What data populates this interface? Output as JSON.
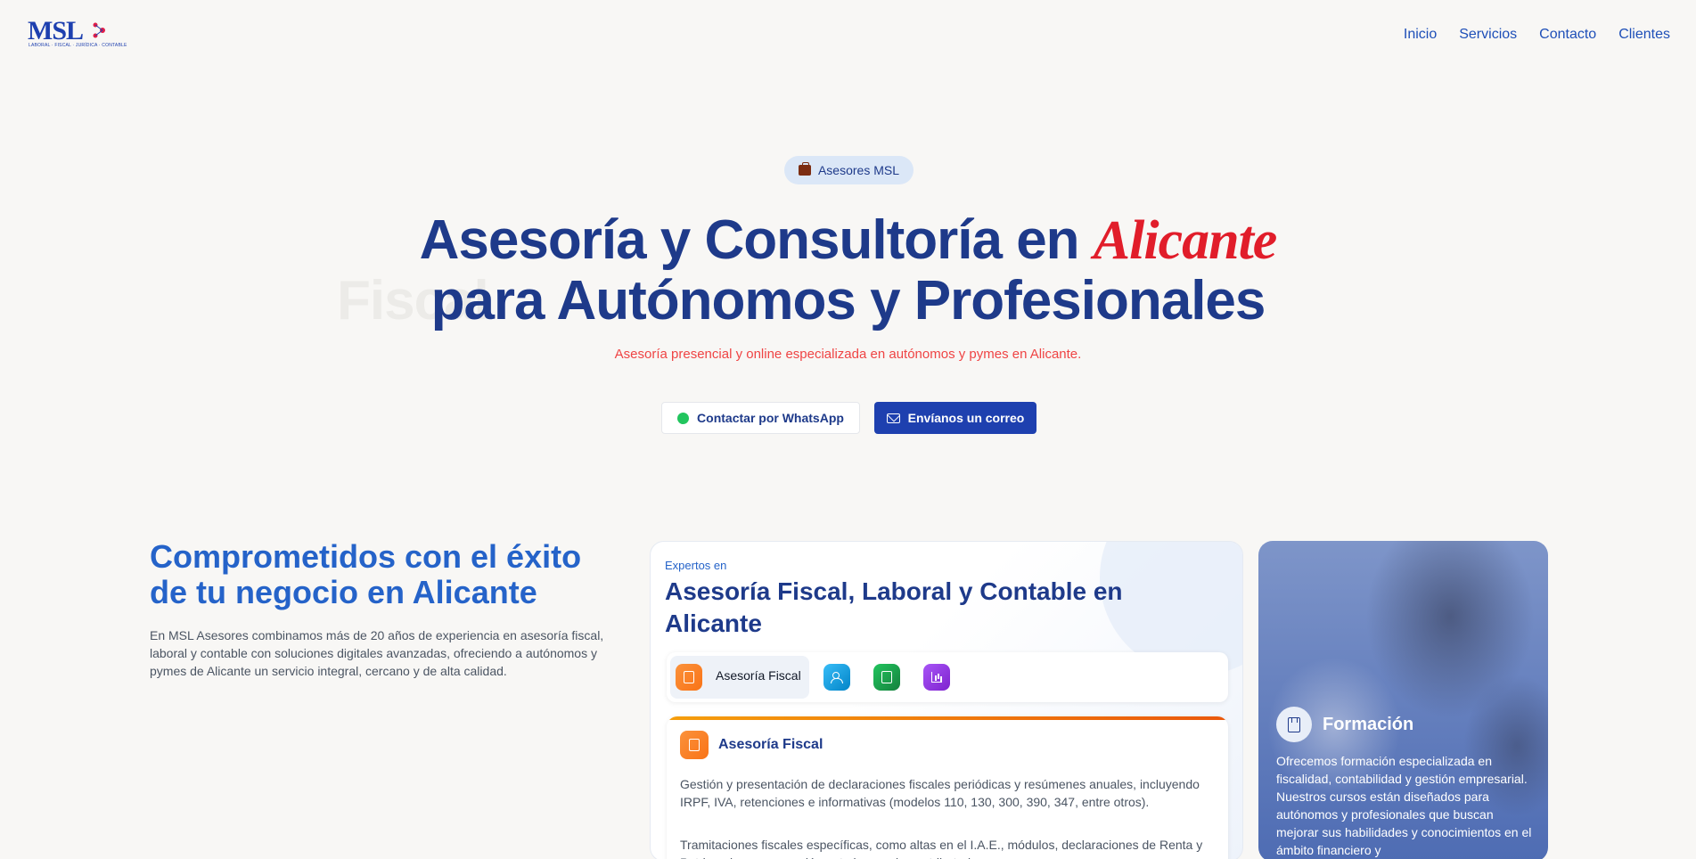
{
  "header": {
    "logo": {
      "mark": "MSL",
      "tagline": "LABORAL · FISCAL · JURÍDICA · CONTABLE"
    },
    "nav": [
      "Inicio",
      "Servicios",
      "Contacto",
      "Clientes"
    ]
  },
  "hero": {
    "badge": "Asesores MSL",
    "title_part1": "Asesoría y Consultoría en ",
    "title_accent": "Alicante",
    "title_line2": "para Autónomos y Profesionales",
    "ghost_word": "Fiscal",
    "subtitle": "Asesoría presencial y online especializada en autónomos y pymes en Alicante.",
    "cta_whatsapp": "Contactar por WhatsApp",
    "cta_email": "Envíanos un correo"
  },
  "about": {
    "title": "Comprometidos con el éxito de tu negocio en Alicante",
    "text": "En MSL Asesores combinamos más de 20 años de experiencia en asesoría fiscal, laboral y contable con soluciones digitales avanzadas, ofreciendo a autónomos y pymes de Alicante un servicio integral, cercano y de alta calidad."
  },
  "services": {
    "eyebrow": "Expertos en",
    "heading": "Asesoría Fiscal, Laboral y Contable en Alicante",
    "active_tab_label": "Asesoría Fiscal",
    "tab_colors": [
      "#f97316",
      "#0ea5e9",
      "#16a34a",
      "#9333ea"
    ],
    "panel": {
      "title": "Asesoría Fiscal",
      "p1": "Gestión y presentación de declaraciones fiscales periódicas y resúmenes anuales, incluyendo IRPF, IVA, retenciones e informativas (modelos 110, 130, 300, 390, 347, entre otros).",
      "p2": "Tramitaciones fiscales específicas, como altas en el I.A.E., módulos, declaraciones de Renta y Patrimonio, y preparación ante inspecciones tributarias."
    }
  },
  "formacion": {
    "title": "Formación",
    "text": "Ofrecemos formación especializada en fiscalidad, contabilidad y gestión empresarial. Nuestros cursos están diseñados para autónomos y profesionales que buscan mejorar sus habilidades y conocimientos en el ámbito financiero y"
  },
  "colors": {
    "primary": "#1e40af",
    "accent_red": "#e11d2a",
    "background": "#f8f7f5"
  }
}
